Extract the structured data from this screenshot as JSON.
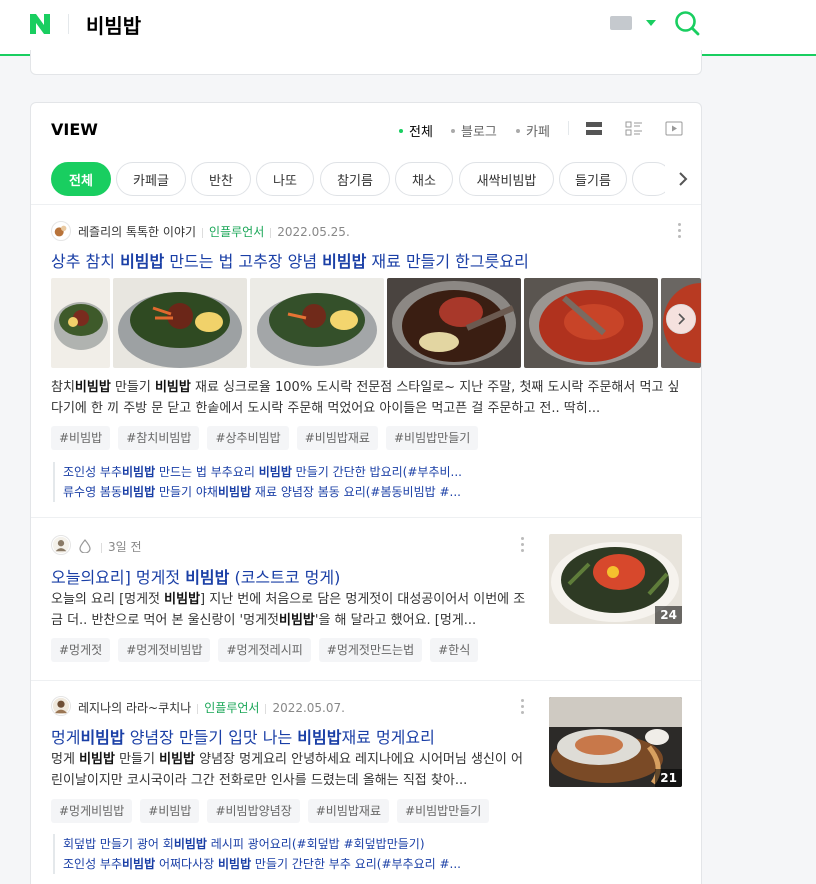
{
  "header": {
    "query": "비빔밥"
  },
  "view": {
    "title": "VIEW",
    "filters": [
      {
        "label": "전체",
        "active": true
      },
      {
        "label": "블로그",
        "active": false
      },
      {
        "label": "카페",
        "active": false
      }
    ],
    "chips": [
      "전체",
      "카페글",
      "반찬",
      "나또",
      "참기름",
      "채소",
      "새싹비빔밥",
      "들기름"
    ]
  },
  "items": [
    {
      "source": "레즐리의 톡톡한 이야기",
      "badge": "인플루언서",
      "date": "2022.05.25.",
      "title": "상추 참치 비빔밥 만드는 법 고추장 양념 비빔밥 재료 만들기 한그릇요리",
      "desc": "참치비빔밥 만들기 비빔밥 재료 싱크로율 100% 도시락 전문점 스타일로~ 지난 주말, 첫째 도시락 주문해서 먹고 싶다기에 한 끼 주방 문 닫고 한솥에서 도시락 주문해 먹었어요 아이들은 먹고픈 걸 주문하고 전.. 딱히...",
      "tags": [
        "#비빔밥",
        "#참치비빔밥",
        "#상추비빔밥",
        "#비빔밥재료",
        "#비빔밥만들기"
      ],
      "related": [
        "조인성 부추비빔밥 만드는 법 부추요리 비빔밥 만들기 간단한 밥요리(#부추비...",
        "류수영 봄동비빔밥 만들기 야채비빔밥 재료 양념장 봄동 요리(#봄동비빔밥 #..."
      ]
    },
    {
      "source": "",
      "date": "3일 전",
      "title": "오늘의요리] 멍게젓 비빔밥 (코스트코 멍게)",
      "desc": "오늘의 요리 [멍게젓 비빔밥] 지난 번에 처음으로 담은 멍게젓이 대성공이어서 이번에 조금 더.. 반찬으로 먹어 본 울신랑이 '멍게젓비빔밥'을 해 달라고 했어요. [멍게...",
      "tags": [
        "#멍게젓",
        "#멍게젓비빔밥",
        "#멍게젓레시피",
        "#멍게젓만드는법",
        "#한식"
      ],
      "count": "24"
    },
    {
      "source": "레지나의 라라~쿠치나",
      "badge": "인플루언서",
      "date": "2022.05.07.",
      "title": "멍게비빔밥 양념장 만들기 입맛 나는 비빔밥재료 멍게요리",
      "desc": "멍게 비빔밥 만들기 비빔밥 양념장 멍게요리 안녕하세요 레지나에요 시어머님 생신이 어린이날이지만 코시국이라 그간 전화로만 인사를 드렸는데 올해는 직접 찾아...",
      "tags": [
        "#멍게비빔밥",
        "#비빔밥",
        "#비빔밥양념장",
        "#비빔밥재료",
        "#비빔밥만들기"
      ],
      "count": "21",
      "related": [
        "회덮밥 만들기 광어 회비빔밥 레시피 광어요리(#회덮밥 #회덮밥만들기)",
        "조인성 부추비빔밥 어쩌다사장 비빔밥 만들기 간단한 부추 요리(#부추요리 #..."
      ]
    }
  ],
  "colors": {
    "accent": "#19ce60",
    "link": "#1a3fa6"
  }
}
